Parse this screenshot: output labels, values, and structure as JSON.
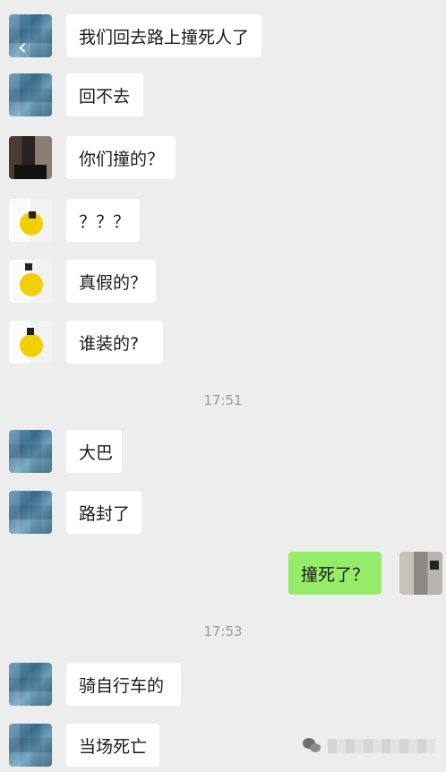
{
  "messages": [
    {
      "text": "我们回去路上撞死人了",
      "side": "left",
      "avatar": "blue"
    },
    {
      "text": "回不去",
      "side": "left",
      "avatar": "blue"
    },
    {
      "text": "你们撞的？",
      "side": "left",
      "avatar": "dark"
    },
    {
      "text": "？？？",
      "side": "left",
      "avatar": "yellow"
    },
    {
      "text": "真假的？",
      "side": "left",
      "avatar": "yellow"
    },
    {
      "text": "谁装的?",
      "side": "left",
      "avatar": "yellow"
    },
    {
      "text": "大巴",
      "side": "left",
      "avatar": "blue"
    },
    {
      "text": "路封了",
      "side": "left",
      "avatar": "blue"
    },
    {
      "text": "撞死了？",
      "side": "right",
      "avatar": "self"
    },
    {
      "text": "骑自行车的",
      "side": "left",
      "avatar": "blue"
    },
    {
      "text": "当场死亡",
      "side": "left",
      "avatar": "blue"
    }
  ],
  "timestamps": [
    "17:51",
    "17:53"
  ],
  "icons": {
    "back": "chevron-left-icon",
    "watermark": "wechat-icon"
  },
  "colors": {
    "background": "#ededed",
    "bubble_other": "#ffffff",
    "bubble_self": "#95ec69",
    "timestamp": "#9a9a9a"
  }
}
